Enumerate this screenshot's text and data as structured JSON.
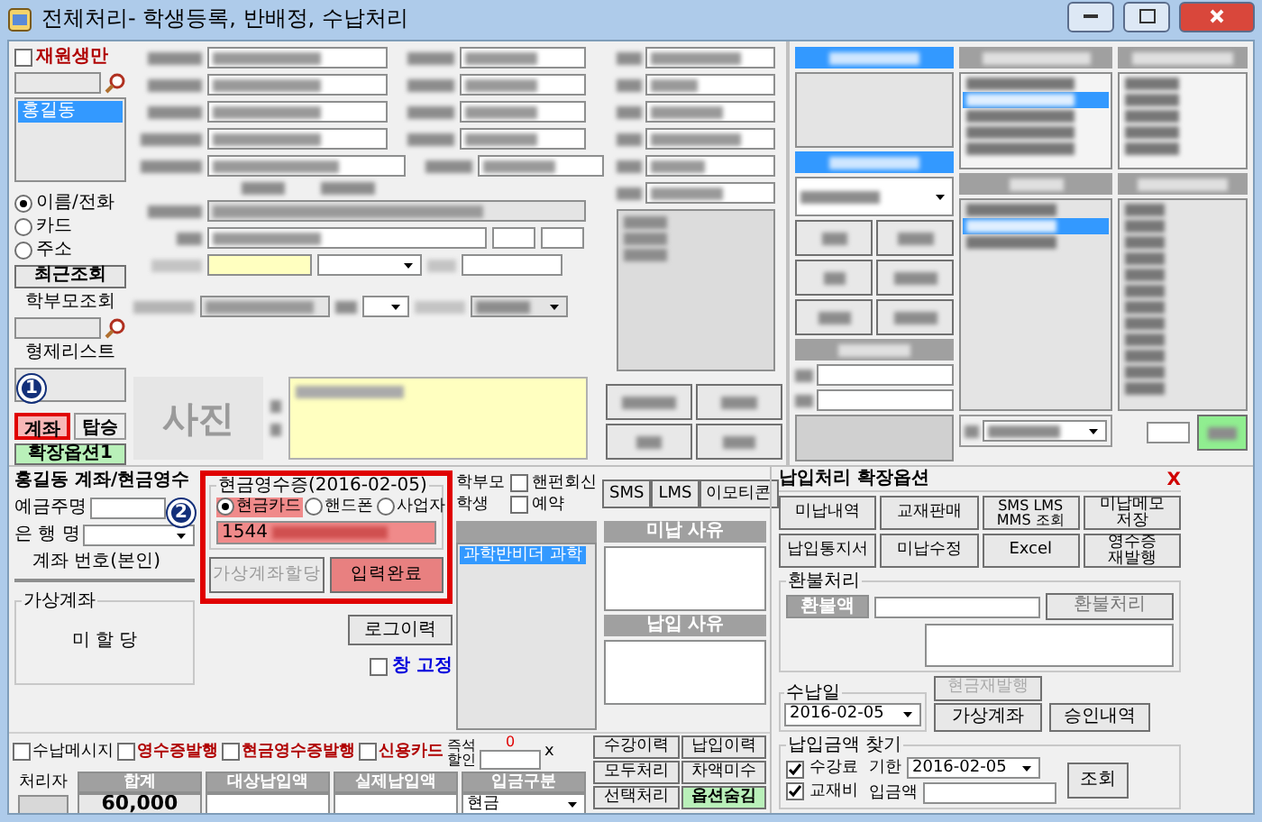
{
  "window": {
    "title": "전체처리- 학생등록, 반배정, 수납처리"
  },
  "sidebar": {
    "enrolled_only": {
      "label": "재원생만",
      "checked": false
    },
    "students": [
      {
        "name": "홍길동",
        "selected": true
      }
    ],
    "search_modes": [
      {
        "label": "이름/전화",
        "selected": true
      },
      {
        "label": "카드",
        "selected": false
      },
      {
        "label": "주소",
        "selected": false
      }
    ],
    "recent_button": "최근조회",
    "parent_search": "학부모조회",
    "siblings": "형제리스트",
    "tabs": [
      {
        "label": "계좌",
        "selected": true
      },
      {
        "label": "탑승",
        "selected": false
      }
    ],
    "option_button": "확장옵션1"
  },
  "photo": {
    "label": "사진"
  },
  "markers": [
    {
      "label": "1"
    },
    {
      "label": "2"
    }
  ],
  "account": {
    "title": "홍길동 계좌/현금영수",
    "holder_label": "예금주명",
    "bank_label": "은 행 명",
    "number_label": "계좌 번호(본인)",
    "virtual_group": "가상계좌",
    "virtual_status": "미 할 당",
    "log_button": "로그이력",
    "pin": {
      "label": "창 고정",
      "checked": false
    }
  },
  "cash_receipt": {
    "title": "현금영수증(2016-02-05)",
    "types": [
      {
        "label": "현금카드",
        "selected": true
      },
      {
        "label": "핸드폰",
        "selected": false
      },
      {
        "label": "사업자",
        "selected": false
      }
    ],
    "number": "1544",
    "buttons": [
      {
        "label": "가상계좌할당",
        "disabled": true,
        "kind": "plain"
      },
      {
        "label": "입력완료",
        "disabled": false,
        "kind": "accent"
      }
    ]
  },
  "recipients": [
    {
      "label": "학부모"
    },
    {
      "label": "학생"
    }
  ],
  "notify": [
    {
      "label": "핸펀회신",
      "checked": false
    },
    {
      "label": "예약",
      "checked": false
    }
  ],
  "message_buttons": [
    "SMS",
    "LMS",
    "이모티콘"
  ],
  "classes": [
    {
      "name": "과학반비더 과학",
      "selected": true
    }
  ],
  "unpaid_reason": {
    "title": "미납 사유"
  },
  "paid_reason": {
    "title": "납입 사유"
  },
  "payment_options": [
    {
      "label": "수납메시지",
      "checked": false,
      "emphasis": false
    },
    {
      "label": "영수증발행",
      "checked": false,
      "emphasis": true
    },
    {
      "label": "현금영수증발행",
      "checked": false,
      "emphasis": true
    },
    {
      "label": "신용카드",
      "checked": false,
      "emphasis": true
    }
  ],
  "discount": {
    "label": "즉석\n할인",
    "count": "0",
    "unit": "x"
  },
  "totals": {
    "handler_label": "처리자",
    "columns": [
      {
        "label": "합계",
        "value": "60,000"
      },
      {
        "label": "대상납입액"
      },
      {
        "label": "실제납입액"
      },
      {
        "label": "입금구분",
        "value": "현금"
      }
    ]
  },
  "action_buttons": [
    {
      "label": "수강이력",
      "kind": "plain"
    },
    {
      "label": "납입이력",
      "kind": "plain"
    },
    {
      "label": "모두처리",
      "kind": "plain"
    },
    {
      "label": "차액미수",
      "kind": "plain"
    },
    {
      "label": "선택처리",
      "kind": "plain"
    },
    {
      "label": "옵션숨김",
      "kind": "accent"
    }
  ],
  "extension": {
    "title": "납입처리 확장옵션",
    "close": "X",
    "buttons": [
      "미납내역",
      "교재판매",
      "SMS LMS\nMMS 조회",
      "미납메모\n저장",
      "납입통지서",
      "미납수정",
      "Excel",
      "영수증\n재발행"
    ],
    "refund": {
      "group": "환불처리",
      "label": "환불액",
      "button": "환불처리"
    },
    "pay_date": {
      "label": "수납일",
      "value": "2016-02-05"
    },
    "reissue_button": {
      "label": "현금재발행",
      "disabled": true
    },
    "virtual_button": "가상계좌",
    "approval_button": "승인내역",
    "search": {
      "group": "납입금액 찾기",
      "items": [
        {
          "label": "수강료",
          "checked": true
        },
        {
          "label": "교재비",
          "checked": true
        }
      ],
      "due_label": "기한",
      "due_value": "2016-02-05",
      "amount_label": "입금액",
      "button": "조회"
    }
  }
}
